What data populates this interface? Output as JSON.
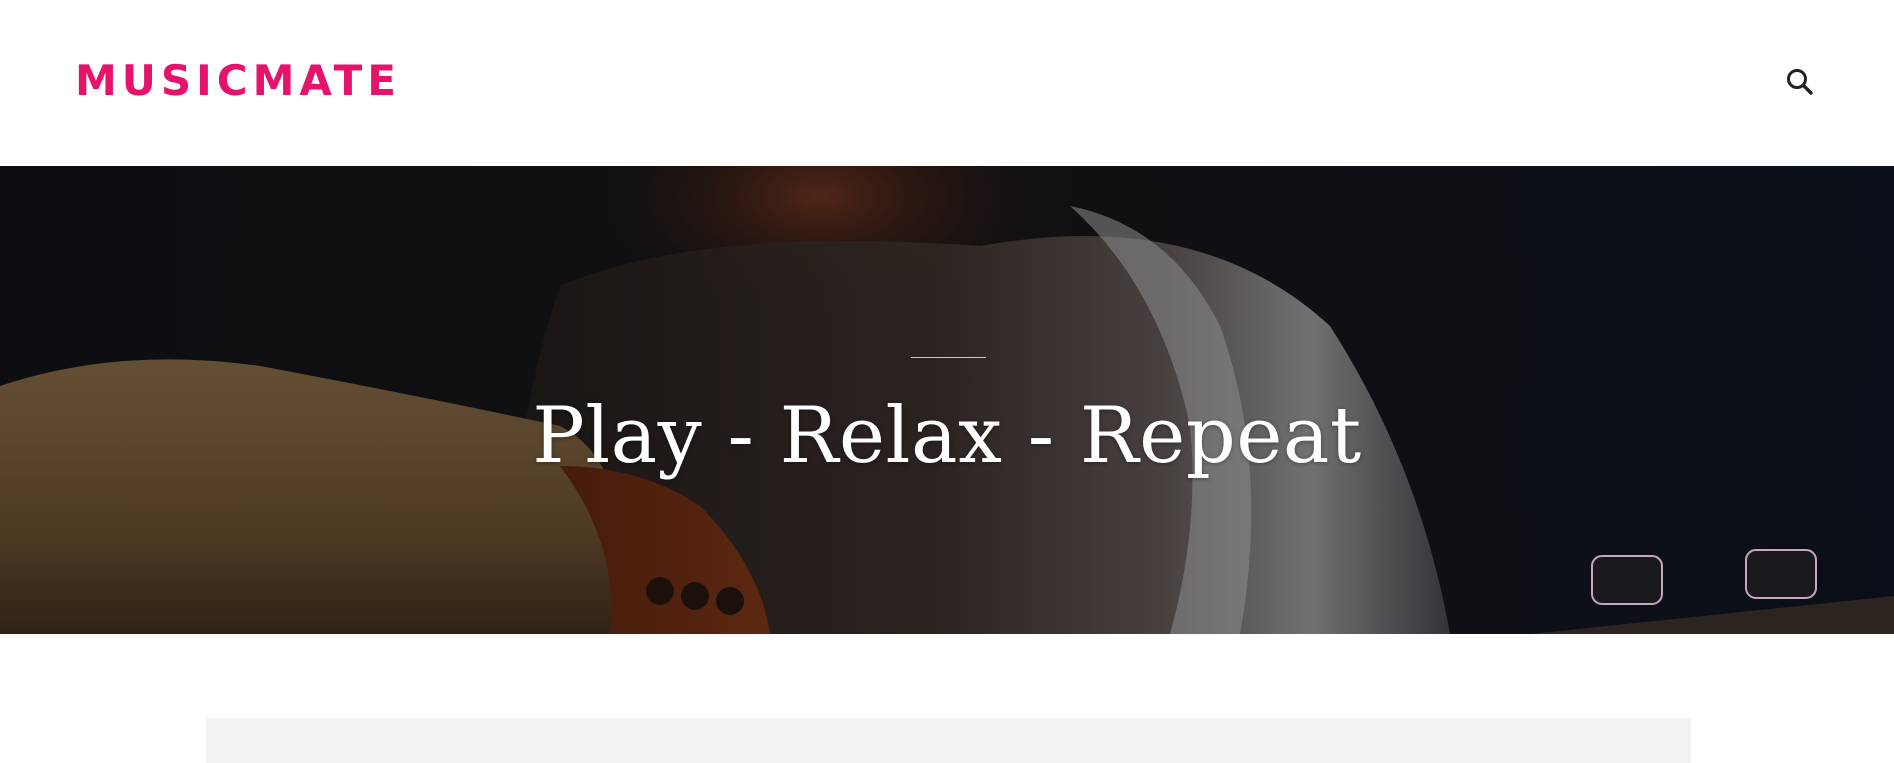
{
  "header": {
    "site_name": "MUSICMATE",
    "brand_color": "#e5136b",
    "search_icon": "search-icon"
  },
  "hero": {
    "title": "Play - Relax - Repeat",
    "background_description_icon": "guitar-player-photo"
  },
  "colors": {
    "hero_overlay": "#16181f",
    "content_panel": "#f3f3f3",
    "text_light": "#ffffff",
    "icon_dark": "#222222"
  }
}
